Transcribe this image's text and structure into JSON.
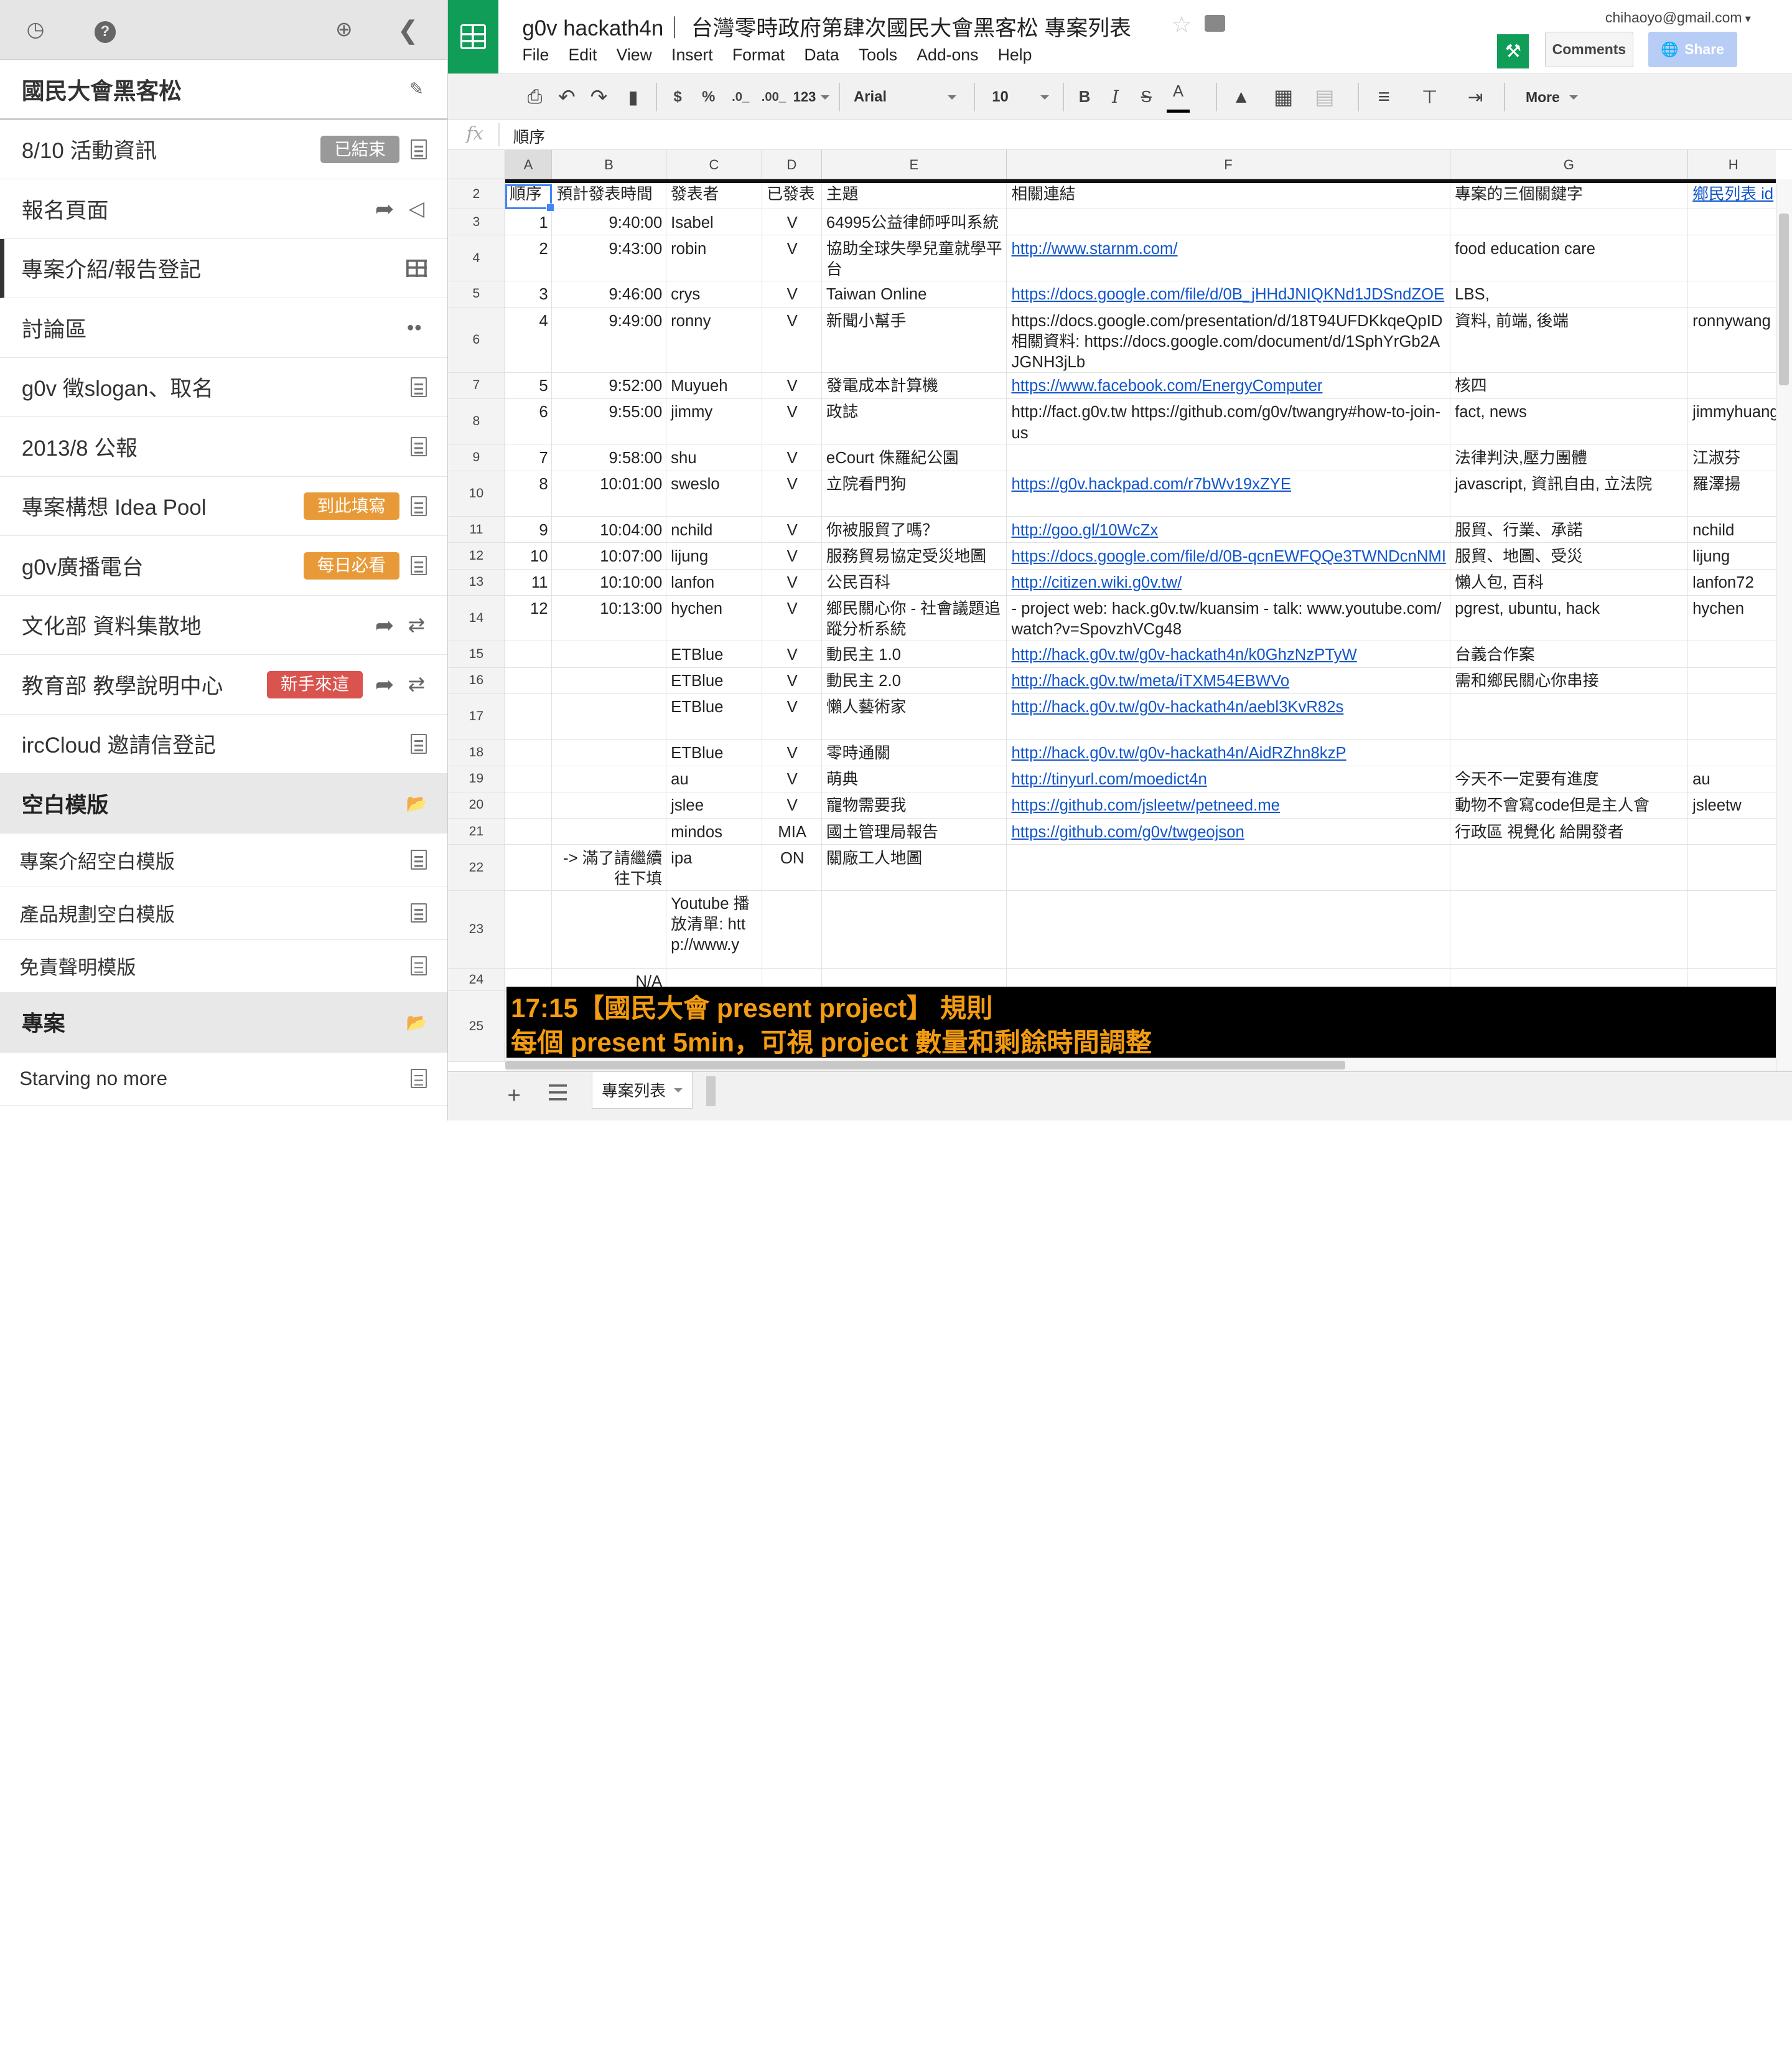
{
  "sidebar": {
    "top_icons": [
      "clock-icon",
      "help-icon",
      "zoom-in-icon",
      "chevron-left-icon"
    ],
    "title": "國民大會黑客松",
    "items": [
      {
        "label": "8/10 活動資訊",
        "badge": "已結束",
        "badge_color": "#999999",
        "icons": [
          "document-icon"
        ]
      },
      {
        "label": "報名頁面",
        "icons": [
          "share-icon",
          "megaphone-icon"
        ]
      },
      {
        "label": "專案介紹/報告登記",
        "icons": [
          "table-icon"
        ],
        "active": true
      },
      {
        "label": "討論區",
        "icons": [
          "group-icon"
        ]
      },
      {
        "label": "g0v 徵slogan、取名",
        "icons": [
          "document-icon"
        ]
      },
      {
        "label": "2013/8 公報",
        "icons": [
          "document-icon"
        ]
      },
      {
        "label": "專案構想 Idea Pool",
        "badge": "到此填寫",
        "badge_color": "#e99a38",
        "icons": [
          "document-icon"
        ]
      },
      {
        "label": "g0v廣播電台",
        "badge": "每日必看",
        "badge_color": "#e99a38",
        "icons": [
          "document-icon"
        ]
      },
      {
        "label": "文化部 資料集散地",
        "icons": [
          "share-icon",
          "swap-icon"
        ]
      },
      {
        "label": "教育部 教學說明中心",
        "badge": "新手來這",
        "badge_color": "#d9534f",
        "icons": [
          "share-icon",
          "swap-icon"
        ]
      },
      {
        "label": "ircCloud 邀請信登記",
        "icons": [
          "document-icon"
        ]
      }
    ],
    "section1": {
      "label": "空白模版",
      "icon": "folder-open-icon"
    },
    "section1_items": [
      "專案介紹空白模版",
      "產品規劃空白模版",
      "免責聲明模版"
    ],
    "section2": {
      "label": "專案",
      "icon": "folder-open-icon"
    },
    "section2_items": [
      "Starving no more"
    ]
  },
  "header": {
    "title": "g0v hackath4n｜ 台灣零時政府第肆次國民大會黑客松 專案列表",
    "menus": [
      "File",
      "Edit",
      "View",
      "Insert",
      "Format",
      "Data",
      "Tools",
      "Add-ons",
      "Help"
    ],
    "account": "chihaoyo@gmail.com",
    "comments_label": "Comments",
    "share_label": "Share"
  },
  "toolbar": {
    "currency": "$",
    "percent": "%",
    "dec_decrease": ".0_",
    "dec_increase": ".00_",
    "format_num": "123",
    "font": "Arial",
    "font_size": "10",
    "bold": "B",
    "italic": "I",
    "strike": "S",
    "text_color_letter": "A",
    "more": "More"
  },
  "formula": {
    "fx": "fx",
    "value": "順序"
  },
  "columns": [
    "A",
    "B",
    "C",
    "D",
    "E",
    "F",
    "G",
    "H"
  ],
  "rows": [
    {
      "n": "2",
      "cells": [
        "順序",
        "預計發表時間",
        "發表者",
        "已發表",
        "主題",
        "相關連結",
        "專案的三個關鍵字",
        "鄉民列表 id"
      ]
    },
    {
      "n": "3",
      "cells": [
        "1",
        "9:40:00",
        "Isabel",
        "V",
        "64995公益律師呼叫系統",
        "",
        "",
        ""
      ]
    },
    {
      "n": "4",
      "cells": [
        "2",
        "9:43:00",
        "robin",
        "V",
        "協助全球失學兒童就學平台",
        "http://www.starnm.com/",
        "food education care",
        ""
      ]
    },
    {
      "n": "5",
      "cells": [
        "3",
        "9:46:00",
        "crys",
        "V",
        "Taiwan Online",
        "https://docs.google.com/file/d/0B_jHHdJNIQKNd1JDSndZOE",
        "LBS,",
        ""
      ]
    },
    {
      "n": "6",
      "cells": [
        "4",
        "9:49:00",
        "ronny",
        "V",
        "新聞小幫手",
        "https://docs.google.com/presentation/d/18T94UFDKkqeQpID 相關資料: https://docs.google.com/document/d/1SphYrGb2AJGNH3jLb",
        "資料, 前端, 後端",
        "ronnywang"
      ]
    },
    {
      "n": "7",
      "cells": [
        "5",
        "9:52:00",
        "Muyueh",
        "V",
        "發電成本計算機",
        "https://www.facebook.com/EnergyComputer",
        "核四",
        ""
      ]
    },
    {
      "n": "8",
      "cells": [
        "6",
        "9:55:00",
        "jimmy",
        "V",
        "政誌",
        "http://fact.g0v.tw https://github.com/g0v/twangry#how-to-join-us",
        "fact, news",
        "jimmyhuang"
      ]
    },
    {
      "n": "9",
      "cells": [
        "7",
        "9:58:00",
        "shu",
        "V",
        "eCourt 侏羅紀公園",
        "",
        "法律判決,壓力團體",
        "江淑芬"
      ]
    },
    {
      "n": "10",
      "cells": [
        "8",
        "10:01:00",
        "sweslo",
        "V",
        "立院看門狗",
        "https://g0v.hackpad.com/r7bWv19xZYE",
        "javascript, 資訊自由, 立法院",
        "羅澤揚"
      ]
    },
    {
      "n": "11",
      "cells": [
        "9",
        "10:04:00",
        "nchild",
        "V",
        "你被服貿了嗎？",
        "http://goo.gl/10WcZx",
        "服貿、行業、承諾",
        "nchild"
      ]
    },
    {
      "n": "12",
      "cells": [
        "10",
        "10:07:00",
        "lijung",
        "V",
        "服務貿易協定受災地圖",
        "https://docs.google.com/file/d/0B-qcnEWFQQe3TWNDcnNMI",
        "服貿、地圖、受災",
        "lijung"
      ]
    },
    {
      "n": "13",
      "cells": [
        "11",
        "10:10:00",
        "lanfon",
        "V",
        "公民百科",
        "http://citizen.wiki.g0v.tw/",
        "懶人包, 百科",
        "lanfon72"
      ]
    },
    {
      "n": "14",
      "cells": [
        "12",
        "10:13:00",
        "hychen",
        "V",
        "鄉民關心你 - 社會議題追蹤分析系統",
        "- project web: hack.g0v.tw/kuansim - talk: www.youtube.com/watch?v=SpovzhVCg48",
        "pgrest, ubuntu, hack",
        "hychen"
      ]
    },
    {
      "n": "15",
      "cells": [
        "",
        "",
        "ETBlue",
        "V",
        "動民主 1.0",
        "http://hack.g0v.tw/g0v-hackath4n/k0GhzNzPTyW",
        "台義合作案",
        ""
      ]
    },
    {
      "n": "16",
      "cells": [
        "",
        "",
        "ETBlue",
        "V",
        "動民主 2.0",
        "http://hack.g0v.tw/meta/iTXM54EBWVo",
        "需和鄉民關心你串接",
        ""
      ]
    },
    {
      "n": "17",
      "cells": [
        "",
        "",
        "ETBlue",
        "V",
        "懶人藝術家",
        "http://hack.g0v.tw/g0v-hackath4n/aebl3KvR82s",
        "",
        ""
      ]
    },
    {
      "n": "18",
      "cells": [
        "",
        "",
        "ETBlue",
        "V",
        "零時通關",
        "http://hack.g0v.tw/g0v-hackath4n/AidRZhn8kzP",
        "",
        ""
      ]
    },
    {
      "n": "19",
      "cells": [
        "",
        "",
        "au",
        "V",
        "萌典",
        "http://tinyurl.com/moedict4n",
        "今天不一定要有進度",
        "au"
      ]
    },
    {
      "n": "20",
      "cells": [
        "",
        "",
        "jslee",
        "V",
        "寵物需要我",
        "https://github.com/jsleetw/petneed.me",
        "動物不會寫code但是主人會",
        "jsleetw"
      ]
    },
    {
      "n": "21",
      "cells": [
        "",
        "",
        "mindos",
        "MIA",
        "國土管理局報告",
        "https://github.com/g0v/twgeojson",
        "行政區 視覺化 給開發者",
        ""
      ]
    },
    {
      "n": "22",
      "cells": [
        "",
        "-> 滿了請繼續往下填",
        "ipa",
        "ON",
        "關廠工人地圖",
        "",
        "",
        ""
      ]
    },
    {
      "n": "23",
      "cells": [
        "",
        "",
        "Youtube 播放清單: http://www.y",
        "",
        "",
        "",
        "",
        ""
      ]
    },
    {
      "n": "24",
      "cells": [
        "",
        "N/A",
        "",
        "",
        "",
        "",
        "",
        ""
      ]
    },
    {
      "n": "25",
      "cells": [
        "",
        "",
        "",
        "",
        "",
        "",
        "",
        ""
      ]
    }
  ],
  "banner": {
    "line1": "17:15【國民大會 present project】 規則",
    "line2": "每個 present 5min，可視 project 數量和剩餘時間調整"
  },
  "sheet_tab": "專案列表",
  "colors": {
    "brand_green": "#0f9d58",
    "link_blue": "#1155cc",
    "banner_orange": "#f39c12",
    "share_blue": "#b7cdf5"
  }
}
